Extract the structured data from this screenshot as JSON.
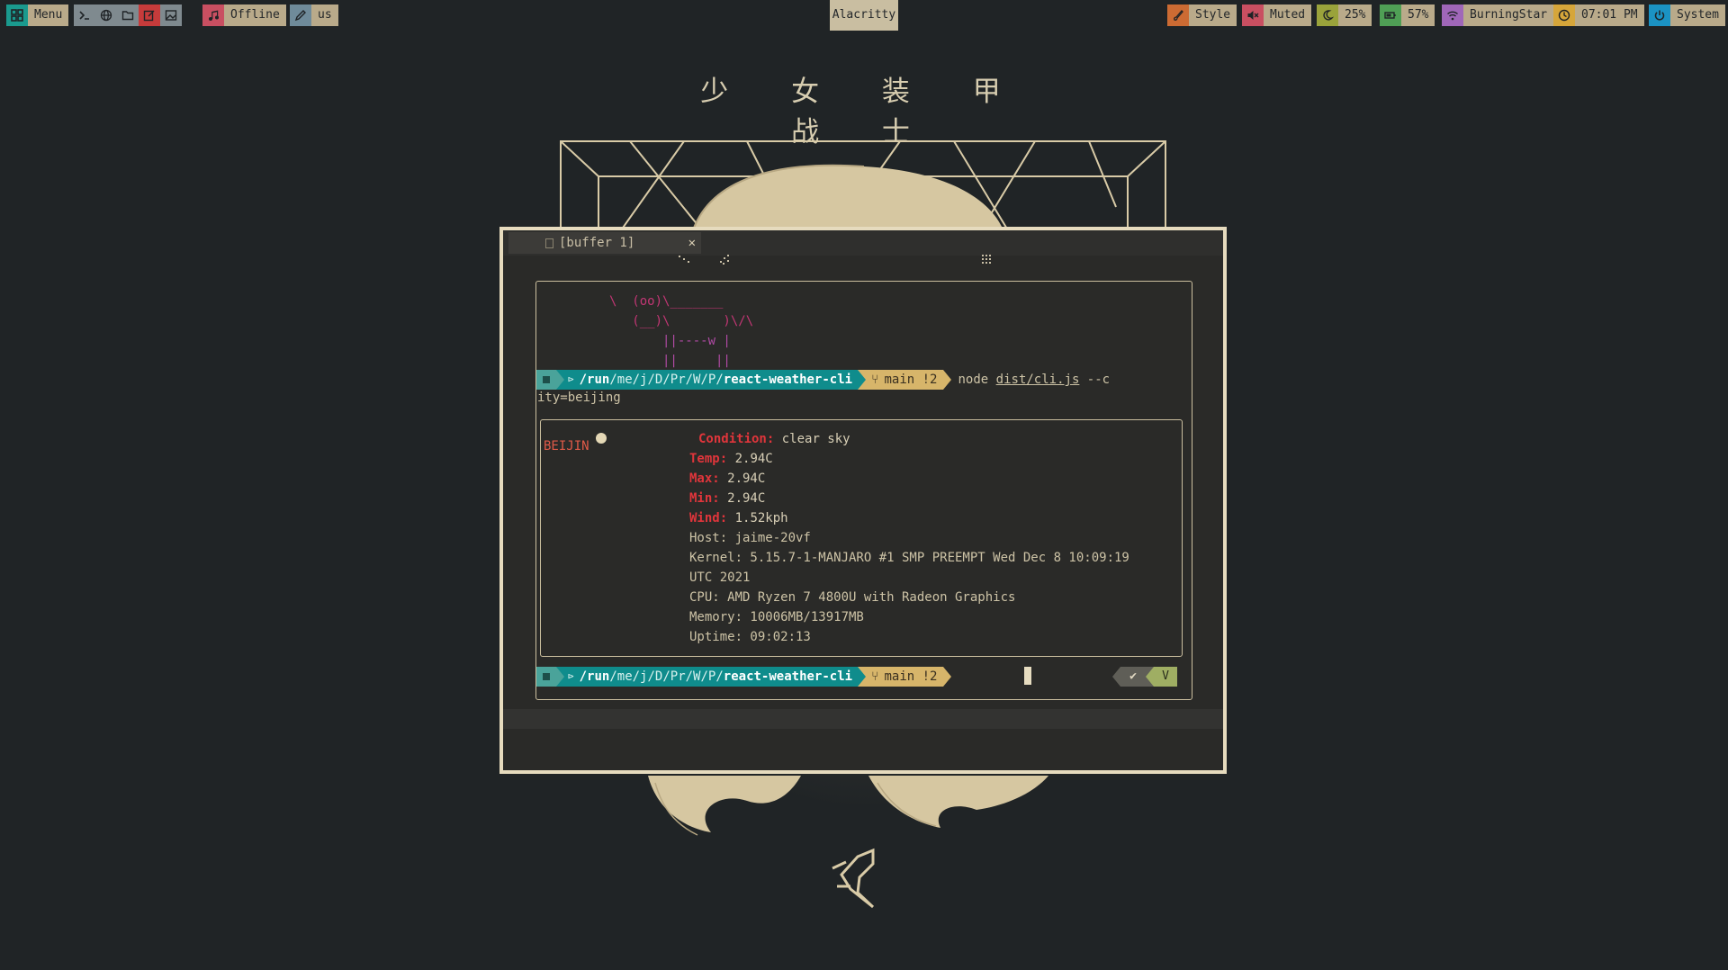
{
  "topbar": {
    "menu_label": "Menu",
    "music_label": "Offline",
    "keyboard_label": "us",
    "active_window": "Alacritty",
    "style_label": "Style",
    "volume_label": "Muted",
    "brightness_label": "25%",
    "battery_label": "57%",
    "wifi_label": "BurningStar",
    "clock_label": "07:01 PM",
    "power_label": "System",
    "colors": {
      "teal": "#1a9a8e",
      "red": "#c63b3b",
      "pink": "#c94f61",
      "grey": "#7f8a8f",
      "orange": "#cc6b33",
      "olive": "#9aa33b",
      "green": "#4f9f55",
      "purple": "#a067b9",
      "gold": "#d6a63a",
      "cyan": "#1b93c4"
    }
  },
  "wallpaper": {
    "title": "少 女 装 甲 战 士"
  },
  "terminal": {
    "tab_title": "[buffer 1]",
    "close_glyph": "✕",
    "ascii": [
      "\\  (oo)\\_______",
      "   (__)\\       )\\/\\",
      "       ||----w |",
      "       ||     ||"
    ],
    "prompt": {
      "path_prefix": "/run",
      "path_middle": "/me/j/D/Pr/W/P/",
      "path_dir": "react-weather-cli",
      "git_branch": "main !2"
    },
    "command": {
      "cmd": "node",
      "file": "dist/cli.js",
      "rest": " --c"
    },
    "command_wrap": "ity=beijing",
    "weather": {
      "city": "BEIJIN",
      "condition_key": "Condition:",
      "condition_val": " clear sky",
      "temp_key": "Temp:",
      "temp_val": " 2.94C",
      "max_key": "Max:",
      "max_val": " 2.94C",
      "min_key": "Min:",
      "min_val": " 2.94C",
      "wind_key": "Wind:",
      "wind_val": " 1.52kph",
      "host": "Host: jaime-20vf",
      "kernel": "Kernel: 5.15.7-1-MANJARO #1 SMP PREEMPT Wed Dec 8 10:09:19",
      "kernel_wrap": "UTC 2021",
      "cpu": "CPU: AMD Ryzen 7 4800U with Radeon Graphics",
      "memory": "Memory: 10006MB/13917MB",
      "uptime": "Uptime: 09:02:13"
    },
    "status_ok": "✔",
    "status_vcs": "V"
  }
}
